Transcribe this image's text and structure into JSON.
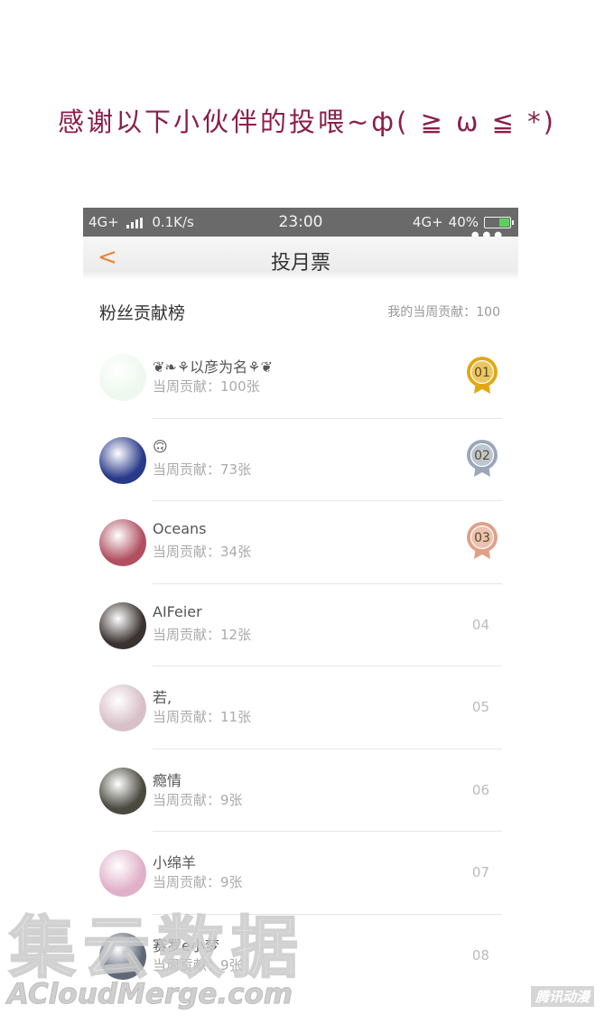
{
  "banner": "感谢以下小伙伴的投喂~ф( ≧ ω ≦ *)",
  "status": {
    "network": "4G+",
    "speed": "0.1K/s",
    "time": "23:00",
    "network_right": "4G+",
    "battery": "40%"
  },
  "header": {
    "title": "投月票",
    "back_label": "<"
  },
  "section": {
    "title": "粉丝贡献榜",
    "my_contribution": "我的当周贡献：100"
  },
  "rows": [
    {
      "name": "❦❧⚘以彦为名⚘❦",
      "contribution": "当周贡献：100张",
      "rank": "01",
      "avatar_color": "#eef8ee"
    },
    {
      "name": "🙃",
      "contribution": "当周贡献：73张",
      "rank": "02",
      "avatar_color": "#2a3a8a"
    },
    {
      "name": "Oceans",
      "contribution": "当周贡献：34张",
      "rank": "03",
      "avatar_color": "#b05060"
    },
    {
      "name": "AIFeier",
      "contribution": "当周贡献：12张",
      "rank": "04",
      "avatar_color": "#3a3230"
    },
    {
      "name": "若,",
      "contribution": "当周贡献：11张",
      "rank": "05",
      "avatar_color": "#d8c0c8"
    },
    {
      "name": "瘾情",
      "contribution": "当周贡献：9张",
      "rank": "06",
      "avatar_color": "#4a4a40"
    },
    {
      "name": "小绵羊",
      "contribution": "当周贡献：9张",
      "rank": "07",
      "avatar_color": "#e0b0c8"
    },
    {
      "name": "赛罗e小梦",
      "contribution": "当周贡献：9张",
      "rank": "08",
      "avatar_color": "#606878"
    }
  ],
  "watermark": {
    "main": "集云数据",
    "url": "ACloudMerge.com",
    "brand": "腾讯动漫"
  },
  "colors": {
    "gold": "#e2a812",
    "silver": "#9aa7b8",
    "bronze": "#e0a088",
    "accent": "#e8833a"
  }
}
